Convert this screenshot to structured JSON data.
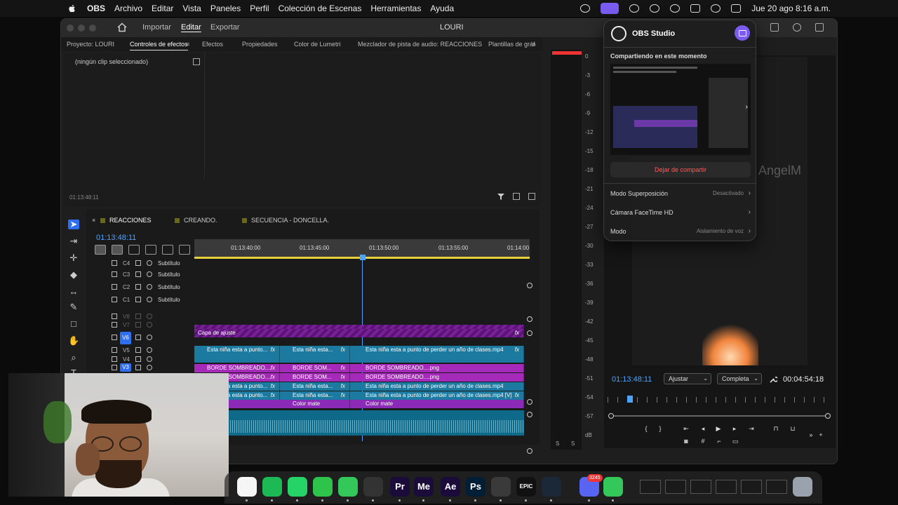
{
  "menubar": {
    "app": "OBS",
    "items": [
      "Archivo",
      "Editar",
      "Vista",
      "Paneles",
      "Perfil",
      "Colección de Escenas",
      "Herramientas",
      "Ayuda"
    ],
    "clock": "Jue 20 ago 8:16 a.m."
  },
  "premiere": {
    "modes": [
      "Importar",
      "Editar",
      "Exportar"
    ],
    "active_mode": "Editar",
    "project_title": "LOURI",
    "panel_tabs": [
      "Proyecto: LOURI",
      "Controles de efectos",
      "Efectos",
      "Propiedades",
      "Color de Lumetri",
      "Mezclador de pista de audio: REACCIONES",
      "Plantillas de gráf"
    ],
    "effects_panel": {
      "clip_label": "(ningún clip seleccionado)",
      "timecode": "01:13:48:11"
    },
    "timeline": {
      "sequence_tabs": [
        "REACCIONES",
        "CREANDO.",
        "SECUENCIA - DONCELLA."
      ],
      "timecode": "01:13:48:11",
      "ruler_ticks": [
        "01:13:40:00",
        "01:13:45:00",
        "01:13:50:00",
        "01:13:55:00",
        "01:14:00"
      ],
      "tracks": [
        {
          "label": "C4",
          "name": "Subtítulo"
        },
        {
          "label": "C3",
          "name": "Subtítulo"
        },
        {
          "label": "C2",
          "name": "Subtítulo"
        },
        {
          "label": "C1",
          "name": "Subtítulo"
        },
        {
          "label": "V8",
          "name": ""
        },
        {
          "label": "V7",
          "name": ""
        },
        {
          "label": "V6",
          "name": ""
        },
        {
          "label": "V5",
          "name": ""
        },
        {
          "label": "V4",
          "name": ""
        },
        {
          "label": "V3",
          "name": ""
        }
      ],
      "clips": {
        "adjust_top": "Capa de ajuste",
        "adjust": "Capa de ajuste",
        "v6_a": "Esta niña esta a punto...",
        "v6_b": "Esta niña esta...",
        "v6_c": "Esta niña esta a punto de perder un año de clases.mp4",
        "v5_a": "BORDE SOMBREADO....",
        "v5_b": "BORDE SOM...",
        "v5_c": "BORDE SOMBREADO....png",
        "v4_a": "BORDE SOMBREADO....",
        "v4_b": "BORDE SOM...",
        "v4_c": "BORDE SOMBREADO....png",
        "v3_a": "Esta niña esta a punto...",
        "v3_b": "Esta niña esta...",
        "v3_c": "Esta niña esta a punto de perder un año de clases.mp4",
        "v2_a": "Esta niña esta a punto...",
        "v2_b": "Esta niña esta...",
        "v2_c": "Esta niña esta a punto de perder un año de clases.mp4 [V]",
        "v1_a": "e",
        "v1_b": "Color mate",
        "v1_c": "Color mate",
        "fx": "fx"
      }
    },
    "meter": {
      "levels": [
        "0",
        "-3",
        "-6",
        "-9",
        "-12",
        "-15",
        "-18",
        "-21",
        "-24",
        "-27",
        "-30",
        "-33",
        "-36",
        "-39",
        "-42",
        "-45",
        "-48",
        "-51",
        "-54",
        "-57",
        "dB"
      ],
      "solo": [
        "S",
        "S"
      ]
    },
    "program": {
      "timecode": "01:13:48:11",
      "fit": "Ajustar",
      "quality": "Completa",
      "duration": "00:04:54:18",
      "watermark": "AngelM"
    }
  },
  "obs_popover": {
    "app_name": "OBS Studio",
    "heading": "Compartiendo en este momento",
    "stop_label": "Dejar de compartir",
    "rows": [
      {
        "label": "Modo Superposición",
        "value": "Desactivado"
      },
      {
        "label": "Cámara FaceTime HD",
        "value": ""
      },
      {
        "label": "Modo",
        "value": "Aislamiento de voz"
      }
    ]
  },
  "dock": {
    "apps": [
      {
        "name": "notes-icon",
        "label": "",
        "color": "#f5f5f5"
      },
      {
        "name": "spotify-icon",
        "label": "",
        "color": "#1db954"
      },
      {
        "name": "whatsapp-icon",
        "label": "",
        "color": "#25d366"
      },
      {
        "name": "facetime-icon",
        "label": "",
        "color": "#2ec44b"
      },
      {
        "name": "messages-icon",
        "label": "",
        "color": "#34c759"
      },
      {
        "name": "obs-icon",
        "label": "",
        "color": "#333333"
      },
      {
        "name": "premiere-icon",
        "label": "Pr",
        "color": "#1a0b3b"
      },
      {
        "name": "media-encoder-icon",
        "label": "Me",
        "color": "#1a0b3b"
      },
      {
        "name": "after-effects-icon",
        "label": "Ae",
        "color": "#1a0b3b"
      },
      {
        "name": "photoshop-icon",
        "label": "Ps",
        "color": "#001e36"
      },
      {
        "name": "davinci-icon",
        "label": "",
        "color": "#3a3a3a"
      },
      {
        "name": "epic-games-icon",
        "label": "EPIC",
        "color": "#111111"
      },
      {
        "name": "steam-icon",
        "label": "",
        "color": "#1b2838"
      },
      {
        "name": "discord-icon",
        "label": "",
        "color": "#5865f2"
      },
      {
        "name": "phone-icon",
        "label": "",
        "color": "#34c759"
      }
    ],
    "discord_badge": "3245"
  }
}
